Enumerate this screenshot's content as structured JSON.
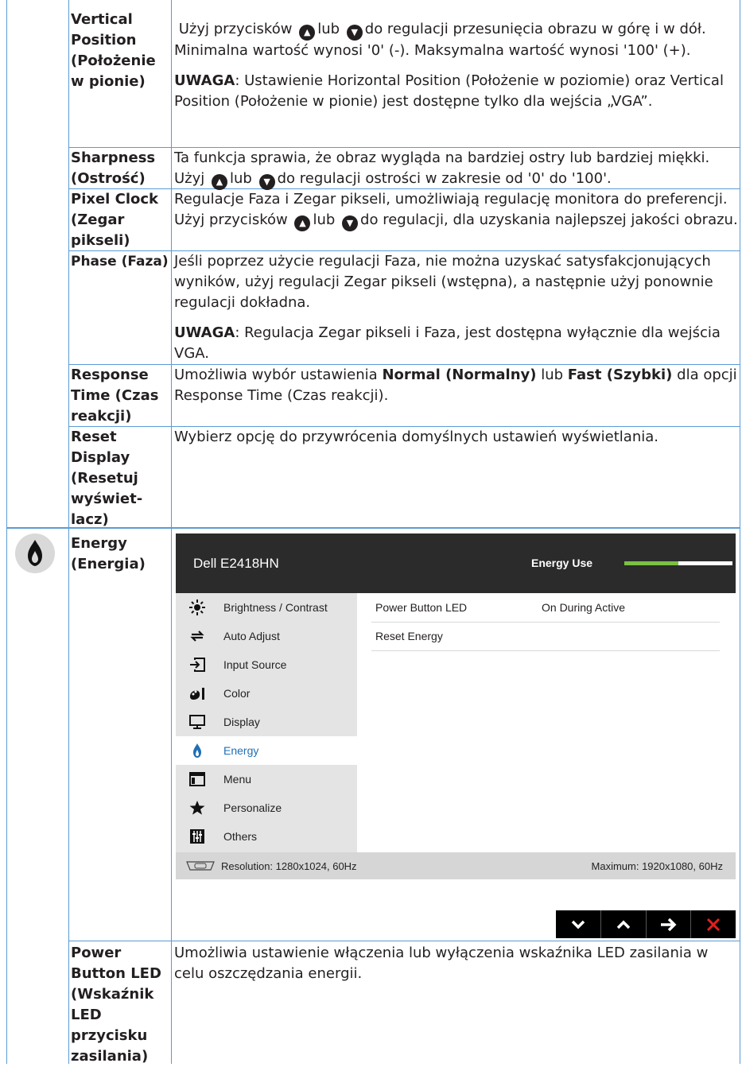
{
  "rows": [
    {
      "term": "Vertical Position (Położenie w pionie)",
      "desc_parts": [
        "Użyj przycisków",
        "lub",
        "do regulacji przesunięcia obrazu w górę i w dół. Minimalna wartość wynosi '0' (-). Maksymalna wartość wynosi '100' (+)."
      ],
      "note_label": "UWAGA",
      "note_text": ": Ustawienie Horizontal Position (Położenie w poziomie) oraz Vertical Position (Położenie w pionie) jest dostępne tylko dla wejścia „VGA”."
    },
    {
      "term": "Sharpness (Ostrość)",
      "desc_parts": [
        "Ta funkcja sprawia, że obraz wygląda na bardziej ostry lub bardziej miękki. Użyj",
        "lub",
        "do regulacji ostrości w zakresie od '0' do '100'."
      ]
    },
    {
      "term": "Pixel Clock (Zegar pikseli)",
      "desc_parts": [
        "Regulacje Faza i Zegar pikseli, umożliwiają regulację monitora do preferencji. Użyj przycisków",
        "lub",
        "do regulacji, dla uzyskania najlepszej jakości obrazu."
      ]
    },
    {
      "term": "Phase (Faza)",
      "desc": "Jeśli poprzez użycie regulacji Faza, nie można uzyskać satysfakcjonujących wyników, użyj regulacji Zegar pikseli (wstępna), a następnie użyj ponownie regulacji dokładna.",
      "note_label": "UWAGA",
      "note_text": ": Regulacja Zegar pikseli i Faza, jest dostępna wyłącznie dla wejścia VGA."
    },
    {
      "term": "Response Time (Czas reakcji)",
      "desc_parts": [
        "Umożliwia wybór ustawienia",
        "Normal (Normalny)",
        "lub",
        "Fast (Szybki)",
        "dla opcji Response Time (Czas reakcji)."
      ]
    },
    {
      "term": "Reset Display (Resetuj wyświet- lacz)",
      "desc": "Wybierz opcję do przywrócenia domyślnych ustawień wyświetlania."
    },
    {
      "term": "Energy (Energia)"
    },
    {
      "term": "Power Button LED (Wskaźnik LED przycisku zasilania)",
      "desc": "Umożliwia ustawienie włączenia lub wyłączenia wskaźnika LED zasilania w celu oszczędzania energii."
    }
  ],
  "osd": {
    "title": "Dell E2418HN",
    "energy_use_label": "Energy Use",
    "energy_use_level": 0.5,
    "menu": [
      {
        "label": "Brightness / Contrast",
        "icon": "brightness-icon"
      },
      {
        "label": "Auto Adjust",
        "icon": "auto-adjust-icon"
      },
      {
        "label": "Input Source",
        "icon": "input-source-icon"
      },
      {
        "label": "Color",
        "icon": "color-icon"
      },
      {
        "label": "Display",
        "icon": "display-icon"
      },
      {
        "label": "Energy",
        "icon": "energy-icon",
        "active": true
      },
      {
        "label": "Menu",
        "icon": "menu-icon"
      },
      {
        "label": "Personalize",
        "icon": "star-icon"
      },
      {
        "label": "Others",
        "icon": "others-icon"
      }
    ],
    "settings": [
      {
        "label": "Power Button LED",
        "value": "On During Active"
      },
      {
        "label": "Reset Energy",
        "value": ""
      }
    ],
    "resolution": "Resolution: 1280x1024, 60Hz",
    "maximum": "Maximum: 1920x1080, 60Hz",
    "colors": {
      "header": "#2b2b2b",
      "accent": "#1f6fb5",
      "energy_bar": "#7ac143",
      "exit": "#e02020"
    }
  }
}
